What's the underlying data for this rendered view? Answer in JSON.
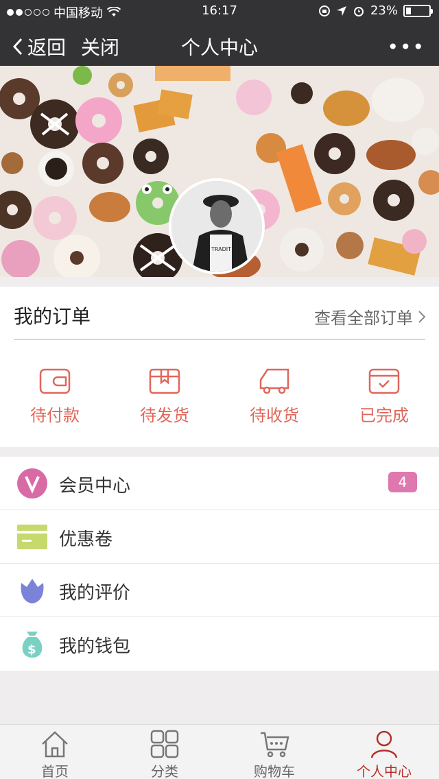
{
  "status": {
    "carrier": "中国移动",
    "time": "16:17",
    "battery_text": "23%",
    "battery_level": 0.23
  },
  "nav": {
    "back_label": "返回",
    "close_label": "关闭",
    "title": "个人中心",
    "more_label": "•••"
  },
  "orders": {
    "title": "我的订单",
    "view_all": "查看全部订单",
    "items": [
      {
        "label": "待付款",
        "icon": "wallet-icon"
      },
      {
        "label": "待发货",
        "icon": "package-icon"
      },
      {
        "label": "待收货",
        "icon": "truck-icon"
      },
      {
        "label": "已完成",
        "icon": "calendar-check-icon"
      }
    ]
  },
  "menu": {
    "items": [
      {
        "label": "会员中心",
        "icon": "vip-icon",
        "badge": "4",
        "color": "#d86aa6"
      },
      {
        "label": "优惠卷",
        "icon": "coupon-icon",
        "color": "#c5d96d"
      },
      {
        "label": "我的评价",
        "icon": "flower-icon",
        "color": "#7b83d8"
      },
      {
        "label": "我的钱包",
        "icon": "money-bag-icon",
        "color": "#79d1c4"
      }
    ]
  },
  "tabbar": {
    "items": [
      {
        "label": "首页",
        "icon": "home-icon"
      },
      {
        "label": "分类",
        "icon": "grid-icon"
      },
      {
        "label": "购物车",
        "icon": "cart-icon"
      },
      {
        "label": "个人中心",
        "icon": "user-icon",
        "active": true
      }
    ]
  },
  "colors": {
    "accent": "#e0665b",
    "active_tab": "#b6302a",
    "navbar": "#333336"
  }
}
